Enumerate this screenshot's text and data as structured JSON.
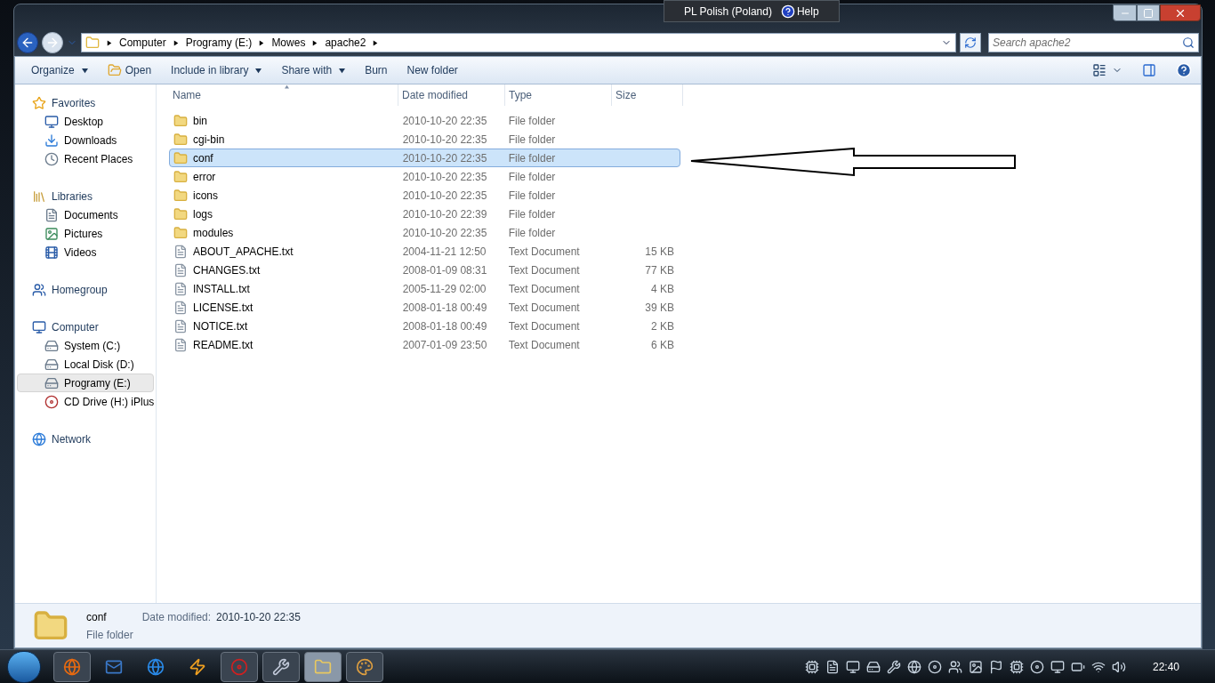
{
  "language_bar": {
    "language": "PL Polish (Poland)",
    "help": "Help"
  },
  "address": {
    "crumbs": [
      "Computer",
      "Programy (E:)",
      "Mowes",
      "apache2"
    ]
  },
  "search": {
    "placeholder": "Search apache2"
  },
  "toolbar": [
    {
      "label": "Organize",
      "kind": "menu"
    },
    {
      "label": "Open",
      "kind": "open"
    },
    {
      "label": "Include in library",
      "kind": "menu"
    },
    {
      "label": "Share with",
      "kind": "menu"
    },
    {
      "label": "Burn",
      "kind": "plain"
    },
    {
      "label": "New folder",
      "kind": "plain"
    }
  ],
  "sidebar": [
    {
      "label": "Favorites",
      "kind": "favorites",
      "items": [
        {
          "label": "Desktop",
          "kind": "desktop",
          "selected": false
        },
        {
          "label": "Downloads",
          "kind": "downloads",
          "selected": false
        },
        {
          "label": "Recent Places",
          "kind": "recent",
          "selected": false
        }
      ]
    },
    {
      "label": "Libraries",
      "kind": "libraries",
      "items": [
        {
          "label": "Documents",
          "kind": "documents",
          "selected": false
        },
        {
          "label": "Pictures",
          "kind": "pictures",
          "selected": false
        },
        {
          "label": "Videos",
          "kind": "videos",
          "selected": false
        }
      ]
    },
    {
      "label": "Homegroup",
      "kind": "homegroup"
    },
    {
      "label": "Computer",
      "kind": "computer",
      "items": [
        {
          "label": "System (C:)",
          "kind": "drive",
          "selected": false
        },
        {
          "label": "Local Disk (D:)",
          "kind": "drive",
          "selected": false
        },
        {
          "label": "Programy (E:)",
          "kind": "drive",
          "selected": true
        },
        {
          "label": "CD Drive (H:) iPlus",
          "kind": "cd",
          "selected": false
        }
      ]
    },
    {
      "label": "Network",
      "kind": "network"
    }
  ],
  "columns": [
    {
      "label": "Name",
      "sorted": true
    },
    {
      "label": "Date modified",
      "sorted": false
    },
    {
      "label": "Type",
      "sorted": false
    },
    {
      "label": "Size",
      "sorted": false
    }
  ],
  "files": [
    {
      "name": "bin",
      "date": "2010-10-20 22:35",
      "type": "File folder",
      "kind": "folder",
      "selected": false
    },
    {
      "name": "cgi-bin",
      "date": "2010-10-20 22:35",
      "type": "File folder",
      "kind": "folder",
      "selected": false
    },
    {
      "name": "conf",
      "date": "2010-10-20 22:35",
      "type": "File folder",
      "kind": "folder",
      "selected": true
    },
    {
      "name": "error",
      "date": "2010-10-20 22:35",
      "type": "File folder",
      "kind": "folder",
      "selected": false
    },
    {
      "name": "icons",
      "date": "2010-10-20 22:35",
      "type": "File folder",
      "kind": "folder",
      "selected": false
    },
    {
      "name": "logs",
      "date": "2010-10-20 22:39",
      "type": "File folder",
      "kind": "folder",
      "selected": false
    },
    {
      "name": "modules",
      "date": "2010-10-20 22:35",
      "type": "File folder",
      "kind": "folder",
      "selected": false
    },
    {
      "name": "ABOUT_APACHE.txt",
      "date": "2004-11-21 12:50",
      "type": "Text Document",
      "size": "15 KB",
      "kind": "text",
      "selected": false
    },
    {
      "name": "CHANGES.txt",
      "date": "2008-01-09 08:31",
      "type": "Text Document",
      "size": "77 KB",
      "kind": "text",
      "selected": false
    },
    {
      "name": "INSTALL.txt",
      "date": "2005-11-29 02:00",
      "type": "Text Document",
      "size": "4 KB",
      "kind": "text",
      "selected": false
    },
    {
      "name": "LICENSE.txt",
      "date": "2008-01-18 00:49",
      "type": "Text Document",
      "size": "39 KB",
      "kind": "text",
      "selected": false
    },
    {
      "name": "NOTICE.txt",
      "date": "2008-01-18 00:49",
      "type": "Text Document",
      "size": "2 KB",
      "kind": "text",
      "selected": false
    },
    {
      "name": "README.txt",
      "date": "2007-01-09 23:50",
      "type": "Text Document",
      "size": "6 KB",
      "kind": "text",
      "selected": false
    }
  ],
  "details": {
    "name": "conf",
    "type": "File folder",
    "date_label": "Date modified:",
    "date": "2010-10-20 22:35"
  },
  "taskbar": {
    "apps": [
      {
        "kind": "fox",
        "running": true,
        "active": false
      },
      {
        "kind": "bird",
        "running": false,
        "active": false
      },
      {
        "kind": "globe",
        "running": false,
        "active": false
      },
      {
        "kind": "bolt",
        "running": false,
        "active": false
      },
      {
        "kind": "redc",
        "running": true,
        "active": false
      },
      {
        "kind": "tool",
        "running": true,
        "active": false
      },
      {
        "kind": "folder",
        "running": true,
        "active": true
      },
      {
        "kind": "palette",
        "running": true,
        "active": false
      }
    ],
    "clock": "22:40"
  }
}
